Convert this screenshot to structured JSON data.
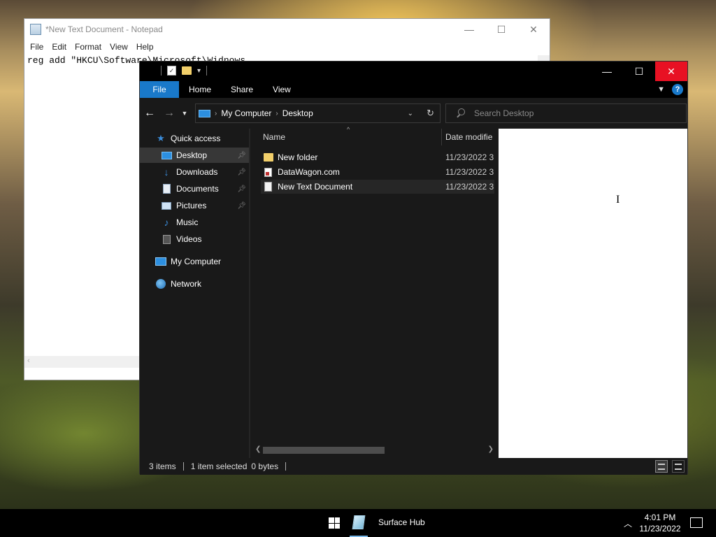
{
  "notepad": {
    "title": "*New Text Document - Notepad",
    "menu": [
      "File",
      "Edit",
      "Format",
      "View",
      "Help"
    ],
    "content": "reg add \"HKCU\\Software\\Microsoft\\Widnows"
  },
  "explorer": {
    "ribbon_tabs": [
      "File",
      "Home",
      "Share",
      "View"
    ],
    "address": [
      "My Computer",
      "Desktop"
    ],
    "search_placeholder": "Search Desktop",
    "nav": {
      "quick_access": "Quick access",
      "items": [
        "Desktop",
        "Downloads",
        "Documents",
        "Pictures",
        "Music",
        "Videos"
      ],
      "my_computer": "My Computer",
      "network": "Network"
    },
    "columns": {
      "name": "Name",
      "date": "Date modifie"
    },
    "files": [
      {
        "name": "New folder",
        "date": "11/23/2022 3:",
        "icon": "folder-icon"
      },
      {
        "name": "DataWagon.com",
        "date": "11/23/2022 3:",
        "icon": "app-icon"
      },
      {
        "name": "New Text Document",
        "date": "11/23/2022 3:",
        "icon": "text-file-icon"
      }
    ],
    "status": {
      "items": "3 items",
      "selected": "1 item selected",
      "size": "0 bytes"
    }
  },
  "taskbar": {
    "app_label": "Surface Hub",
    "time": "4:01 PM",
    "date": "11/23/2022"
  },
  "colors": {
    "accent": "#1979ca",
    "close": "#e81123"
  }
}
